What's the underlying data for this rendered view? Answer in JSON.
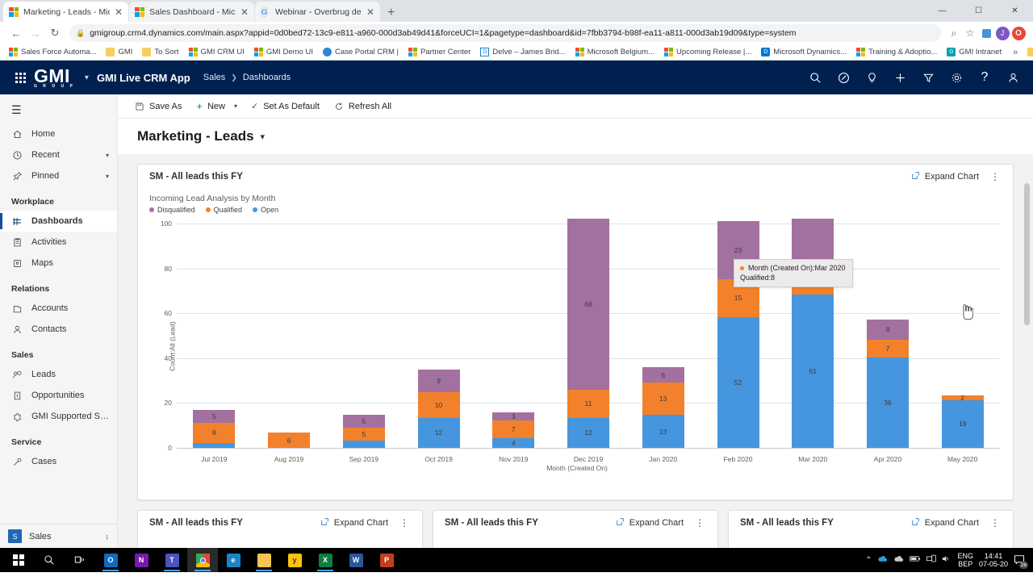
{
  "browser": {
    "tabs": [
      {
        "title": "Marketing - Leads - Microsoft Dy",
        "favicon": "microsoft-icon",
        "active": true
      },
      {
        "title": "Sales Dashboard - Microsoft Dyn",
        "favicon": "microsoft-icon",
        "active": false
      },
      {
        "title": "Webinar - Overbrug de kloof tus",
        "favicon": "google-icon",
        "active": false
      }
    ],
    "new_tab_label": "+",
    "window_controls": {
      "minimize": "—",
      "maximize": "☐",
      "close": "✕"
    },
    "nav": {
      "back": "←",
      "forward": "→",
      "reload": "↻"
    },
    "url": "gmigroup.crm4.dynamics.com/main.aspx?appid=0d0bed72-13c9-e811-a960-000d3ab49d41&forceUCI=1&pagetype=dashboard&id=7fbb3794-b98f-ea11-a811-000d3ab19d09&type=system",
    "lock_icon": "🔒",
    "toolbar_icons": [
      "zoom-icon",
      "star-icon",
      "extension-icon"
    ],
    "profile_initial": "J",
    "opera_initial": "O",
    "bookmarks": [
      {
        "label": "Sales Force Automa...",
        "icon": "microsoft-icon"
      },
      {
        "label": "GMI",
        "icon": "folder-icon"
      },
      {
        "label": "To Sort",
        "icon": "folder-icon"
      },
      {
        "label": "GMI CRM UI",
        "icon": "microsoft-icon"
      },
      {
        "label": "GMI Demo UI",
        "icon": "microsoft-icon"
      },
      {
        "label": "Case Portal CRM |",
        "icon": "globe-icon"
      },
      {
        "label": "Partner Center",
        "icon": "microsoft-icon"
      },
      {
        "label": "Delve – James Brid...",
        "icon": "delve-icon"
      },
      {
        "label": "Microsoft Belgium...",
        "icon": "microsoft-icon"
      },
      {
        "label": "Upcoming Release |...",
        "icon": "microsoft-icon"
      },
      {
        "label": "Microsoft Dynamics...",
        "icon": "dynamics-icon"
      },
      {
        "label": "Training & Adoptio...",
        "icon": "microsoft-icon"
      },
      {
        "label": "GMI Intranet",
        "icon": "gmi-icon"
      }
    ],
    "overflow_label": "»",
    "other_bookmarks": "Other bookmarks"
  },
  "app_header": {
    "waffle": "app-launcher-icon",
    "logo_text": "GMI",
    "logo_sub": "G R O U P",
    "app_name": "GMI Live CRM App",
    "breadcrumb": [
      "Sales",
      "Dashboards"
    ],
    "icons": [
      {
        "name": "search-icon",
        "glyph": "⌕"
      },
      {
        "name": "assistant-icon",
        "glyph": "✇"
      },
      {
        "name": "lightbulb-icon",
        "glyph": "○"
      },
      {
        "name": "quick-create-icon",
        "glyph": "＋"
      },
      {
        "name": "filter-icon",
        "glyph": "∇"
      },
      {
        "name": "settings-icon",
        "glyph": "⚙"
      },
      {
        "name": "help-icon",
        "glyph": "?"
      },
      {
        "name": "user-icon",
        "glyph": "○"
      }
    ]
  },
  "sidebar": {
    "hamburger": "☰",
    "top_items": [
      {
        "label": "Home",
        "icon": "home-icon",
        "chevron": false
      },
      {
        "label": "Recent",
        "icon": "clock-icon",
        "chevron": true
      },
      {
        "label": "Pinned",
        "icon": "pin-icon",
        "chevron": true
      }
    ],
    "groups": [
      {
        "title": "Workplace",
        "items": [
          {
            "label": "Dashboards",
            "icon": "dashboard-icon",
            "selected": true
          },
          {
            "label": "Activities",
            "icon": "activities-icon",
            "selected": false
          },
          {
            "label": "Maps",
            "icon": "maps-icon",
            "selected": false
          }
        ]
      },
      {
        "title": "Relations",
        "items": [
          {
            "label": "Accounts",
            "icon": "accounts-icon",
            "selected": false
          },
          {
            "label": "Contacts",
            "icon": "contacts-icon",
            "selected": false
          }
        ]
      },
      {
        "title": "Sales",
        "items": [
          {
            "label": "Leads",
            "icon": "leads-icon",
            "selected": false
          },
          {
            "label": "Opportunities",
            "icon": "opportunities-icon",
            "selected": false
          },
          {
            "label": "GMI Supported Solut...",
            "icon": "solutions-icon",
            "selected": false
          }
        ]
      },
      {
        "title": "Service",
        "items": [
          {
            "label": "Cases",
            "icon": "cases-icon",
            "selected": false
          }
        ]
      }
    ],
    "area_switcher": {
      "badge": "S",
      "label": "Sales",
      "chevron": "⌃"
    }
  },
  "command_bar": {
    "items": [
      {
        "label": "Save As",
        "icon": "save-as-icon",
        "chevron": false
      },
      {
        "label": "New",
        "icon": "plus-icon",
        "chevron": true
      },
      {
        "label": "Set As Default",
        "icon": "check-icon",
        "chevron": false
      },
      {
        "label": "Refresh All",
        "icon": "refresh-icon",
        "chevron": false
      }
    ]
  },
  "page": {
    "title": "Marketing - Leads",
    "title_chevron": "⌄"
  },
  "tiles": {
    "main": {
      "title": "SM - All leads this FY",
      "expand_label": "Expand Chart",
      "expand_icon": "expand-icon",
      "kebab": "⋮"
    },
    "row2": [
      {
        "title": "SM - All leads this FY",
        "expand_label": "Expand Chart",
        "kebab": "⋮"
      },
      {
        "title": "SM - All leads this FY",
        "expand_label": "Expand Chart",
        "kebab": "⋮"
      },
      {
        "title": "SM - All leads this FY",
        "expand_label": "Expand Chart",
        "kebab": "⋮"
      }
    ]
  },
  "tooltip": {
    "line1": "Month (Created On):Mar 2020",
    "line2": "Qualified:8"
  },
  "chart_data": {
    "type": "bar",
    "stacked": true,
    "title": "Incoming Lead Analysis by Month",
    "xlabel": "Month (Created On)",
    "ylabel": "Count:All (Lead)",
    "ylim": [
      0,
      100
    ],
    "yticks": [
      0,
      20,
      40,
      60,
      80,
      100
    ],
    "grid": true,
    "legend_position": "top-left",
    "categories": [
      "Jul 2019",
      "Aug 2019",
      "Sep 2019",
      "Oct 2019",
      "Nov 2019",
      "Dec 2019",
      "Jan 2020",
      "Feb 2020",
      "Mar 2020",
      "Apr 2020",
      "May 2020"
    ],
    "series": [
      {
        "name": "Open",
        "color": "#4596df",
        "values": [
          2,
          0,
          3,
          12,
          4,
          12,
          13,
          52,
          61,
          36,
          19
        ]
      },
      {
        "name": "Qualified",
        "color": "#f3812b",
        "values": [
          8,
          6,
          5,
          10,
          7,
          11,
          13,
          15,
          8,
          7,
          2
        ]
      },
      {
        "name": "Disqualified",
        "color": "#a2719f",
        "values": [
          5,
          0,
          5,
          9,
          3,
          68,
          6,
          23,
          22,
          8,
          0
        ]
      }
    ],
    "labels": {
      "Open": [
        "",
        "",
        "",
        "12",
        "4",
        "12",
        "13",
        "52",
        "61",
        "36",
        "19"
      ],
      "Qualified": [
        "8",
        "6",
        "5",
        "10",
        "7",
        "11",
        "13",
        "15",
        "8",
        "7",
        "2"
      ],
      "Disqualified": [
        "5",
        "",
        "5",
        "9",
        "3",
        "68",
        "6",
        "23",
        "",
        "8",
        ""
      ]
    }
  },
  "taskbar": {
    "start": "windows-icon",
    "search": "search-icon",
    "taskview": "task-view-icon",
    "apps": [
      {
        "name": "outlook-icon",
        "label": "O",
        "color": "#0f6cbd",
        "running": true,
        "active": false
      },
      {
        "name": "onenote-icon",
        "label": "N",
        "color": "#7719aa",
        "running": false,
        "active": false
      },
      {
        "name": "teams-icon",
        "label": "T",
        "color": "#4b53bc",
        "running": true,
        "active": false
      },
      {
        "name": "chrome-icon",
        "label": "",
        "color": "#f5b400",
        "running": true,
        "active": true
      },
      {
        "name": "edge-icon",
        "label": "e",
        "color": "#1b84c8",
        "running": false,
        "active": false
      },
      {
        "name": "file-explorer-icon",
        "label": "",
        "color": "#f5c451",
        "running": true,
        "active": false
      },
      {
        "name": "yammer-icon",
        "label": "y",
        "color": "#ffc20e",
        "running": false,
        "active": false
      },
      {
        "name": "excel-icon",
        "label": "X",
        "color": "#107c41",
        "running": true,
        "active": false
      },
      {
        "name": "word-icon",
        "label": "W",
        "color": "#2b579a",
        "running": false,
        "active": false
      },
      {
        "name": "powerpoint-icon",
        "label": "P",
        "color": "#c43e1c",
        "running": false,
        "active": false
      }
    ],
    "tray": {
      "chevron": "⌃",
      "icons": [
        "onedrive-icon",
        "cloud-icon",
        "battery-icon",
        "network-icon",
        "volume-icon"
      ],
      "lang_line1": "ENG",
      "lang_line2": "BEP",
      "time": "14:41",
      "date": "07-05-20",
      "notification_count": "26"
    }
  }
}
